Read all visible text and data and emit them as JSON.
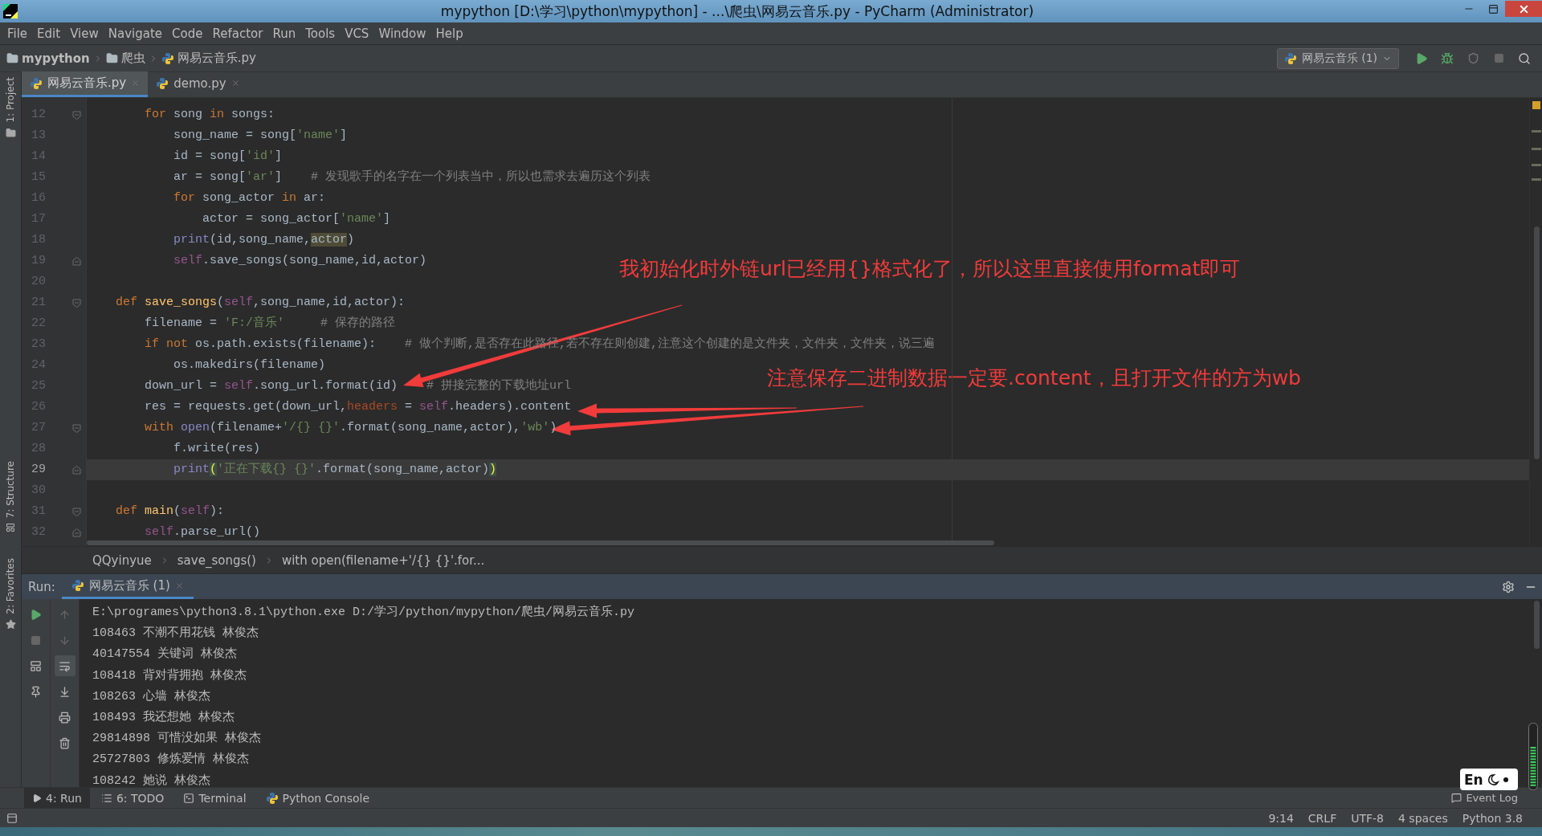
{
  "window": {
    "title": "mypython [D:\\学习\\python\\mypython] - ...\\爬虫\\网易云音乐.py - PyCharm (Administrator)"
  },
  "menu": [
    "File",
    "Edit",
    "View",
    "Navigate",
    "Code",
    "Refactor",
    "Run",
    "Tools",
    "VCS",
    "Window",
    "Help"
  ],
  "navbar": {
    "crumbs": [
      {
        "label": "mypython",
        "kind": "folder"
      },
      {
        "label": "爬虫",
        "kind": "folder"
      },
      {
        "label": "网易云音乐.py",
        "kind": "python"
      }
    ],
    "run_config": "网易云音乐 (1)"
  },
  "side_tools": {
    "top": "1: Project",
    "structure": "7: Structure",
    "favorites": "2: Favorites"
  },
  "editor": {
    "tabs": [
      {
        "label": "网易云音乐.py",
        "selected": true
      },
      {
        "label": "demo.py",
        "selected": false
      }
    ],
    "lines": [
      {
        "number": "12",
        "current": false,
        "fold_start": true,
        "tokens": [
          {
            "kind": "kw",
            "text": "        for"
          },
          {
            "kind": "pl",
            "text": " song "
          },
          {
            "kind": "kw",
            "text": "in"
          },
          {
            "kind": "pl",
            "text": " songs:"
          }
        ]
      },
      {
        "number": "13",
        "current": false,
        "tokens": [
          {
            "kind": "pl",
            "text": "            song_name = song["
          },
          {
            "kind": "str",
            "text": "'name'"
          },
          {
            "kind": "pl",
            "text": "]"
          }
        ]
      },
      {
        "number": "14",
        "current": false,
        "tokens": [
          {
            "kind": "pl",
            "text": "            id = song["
          },
          {
            "kind": "str",
            "text": "'id'"
          },
          {
            "kind": "pl",
            "text": "]"
          }
        ]
      },
      {
        "number": "15",
        "current": false,
        "tokens": [
          {
            "kind": "pl",
            "text": "            ar = song["
          },
          {
            "kind": "str",
            "text": "'ar'"
          },
          {
            "kind": "pl",
            "text": "]"
          },
          {
            "kind": "cm",
            "text": "    # 发现歌手的名字在一个列表当中，所以也需求去遍历这个列表"
          }
        ]
      },
      {
        "number": "16",
        "current": false,
        "tokens": [
          {
            "kind": "kw",
            "text": "            for"
          },
          {
            "kind": "pl",
            "text": " song_actor "
          },
          {
            "kind": "kw",
            "text": "in"
          },
          {
            "kind": "pl",
            "text": " ar:"
          }
        ]
      },
      {
        "number": "17",
        "current": false,
        "tokens": [
          {
            "kind": "pl",
            "text": "                actor = song_actor["
          },
          {
            "kind": "str",
            "text": "'name'"
          },
          {
            "kind": "pl",
            "text": "]"
          }
        ]
      },
      {
        "number": "18",
        "current": false,
        "tokens": [
          {
            "kind": "bi",
            "text": "            print"
          },
          {
            "kind": "pl",
            "text": "(id,song_name,"
          },
          {
            "kind": "hl",
            "text": "actor"
          },
          {
            "kind": "pl",
            "text": ")"
          }
        ]
      },
      {
        "number": "19",
        "current": false,
        "fold_end": true,
        "tokens": [
          {
            "kind": "self",
            "text": "            self"
          },
          {
            "kind": "pl",
            "text": ".save_songs(song_name,id,actor)"
          }
        ]
      },
      {
        "number": "20",
        "current": false
      },
      {
        "number": "21",
        "current": false,
        "fold_start": true,
        "tokens": [
          {
            "kind": "kw",
            "text": "    def"
          },
          {
            "kind": "fn",
            "text": " save_songs"
          },
          {
            "kind": "pl",
            "text": "("
          },
          {
            "kind": "self",
            "text": "self"
          },
          {
            "kind": "pl",
            "text": ",song_name,id,actor):"
          }
        ]
      },
      {
        "number": "22",
        "current": false,
        "tokens": [
          {
            "kind": "pl",
            "text": "        filename = "
          },
          {
            "kind": "str",
            "text": "'F:/音乐'"
          },
          {
            "kind": "cm",
            "text": "     # 保存的路径"
          }
        ]
      },
      {
        "number": "23",
        "current": false,
        "tokens": [
          {
            "kind": "kw",
            "text": "        if not"
          },
          {
            "kind": "pl",
            "text": " os.path.exists(filename):"
          },
          {
            "kind": "cm",
            "text": "    # 做个判断,是否存在此路径,若不存在则创建,注意这个创建的是文件夹，文件夹，文件夹，说三遍"
          }
        ]
      },
      {
        "number": "24",
        "current": false,
        "tokens": [
          {
            "kind": "pl",
            "text": "            os.makedirs(filename)"
          }
        ]
      },
      {
        "number": "25",
        "current": false,
        "tokens": [
          {
            "kind": "pl",
            "text": "        down_url = "
          },
          {
            "kind": "self",
            "text": "self"
          },
          {
            "kind": "pl",
            "text": ".song_url.format(id)"
          },
          {
            "kind": "cm",
            "text": "    # 拼接完整的下载地址url"
          }
        ]
      },
      {
        "number": "26",
        "current": false,
        "tokens": [
          {
            "kind": "pl",
            "text": "        res = requests.get(down_url,"
          },
          {
            "kind": "par",
            "text": "headers"
          },
          {
            "kind": "pl",
            "text": " = "
          },
          {
            "kind": "self",
            "text": "self"
          },
          {
            "kind": "pl",
            "text": ".headers).content"
          }
        ]
      },
      {
        "number": "27",
        "current": false,
        "fold_start": true,
        "tokens": [
          {
            "kind": "kw",
            "text": "        with"
          },
          {
            "kind": "bi",
            "text": " open"
          },
          {
            "kind": "pl",
            "text": "(filename+"
          },
          {
            "kind": "str",
            "text": "'/{} {}'"
          },
          {
            "kind": "pl",
            "text": ".format(song_name,actor),"
          },
          {
            "kind": "str",
            "text": "'wb'"
          },
          {
            "kind": "pl",
            "text": ")"
          }
        ]
      },
      {
        "number": "28",
        "current": false,
        "tokens": [
          {
            "kind": "pl",
            "text": "            f.write(res)"
          }
        ]
      },
      {
        "number": "29",
        "current": true,
        "fold_end": true,
        "tokens": [
          {
            "kind": "bi",
            "text": "            print"
          },
          {
            "kind": "br",
            "text": "("
          },
          {
            "kind": "str",
            "text": "'正在下载{} {}'"
          },
          {
            "kind": "pl",
            "text": ".format(song_name,actor)"
          },
          {
            "kind": "br",
            "text": ")"
          }
        ]
      },
      {
        "number": "30",
        "current": false
      },
      {
        "number": "31",
        "current": false,
        "fold_start": true,
        "tokens": [
          {
            "kind": "kw",
            "text": "    def"
          },
          {
            "kind": "fn",
            "text": " main"
          },
          {
            "kind": "pl",
            "text": "("
          },
          {
            "kind": "self",
            "text": "self"
          },
          {
            "kind": "pl",
            "text": "):"
          }
        ]
      },
      {
        "number": "32",
        "current": false,
        "fold_end": true,
        "tokens": [
          {
            "kind": "self",
            "text": "        self"
          },
          {
            "kind": "pl",
            "text": ".parse_url()"
          }
        ]
      }
    ],
    "annotations": [
      {
        "text": "我初始化时外链url已经用{}格式化了，所以这里直接使用format即可"
      },
      {
        "text": "注意保存二进制数据一定要.content，且打开文件的方为wb"
      }
    ],
    "breadcrumbs": [
      "QQyinyue",
      "save_songs()",
      "with open(filename+'/{} {}'.for..."
    ]
  },
  "run_panel": {
    "label": "Run:",
    "tabs": [
      {
        "label": "网易云音乐 (1)",
        "selected": true
      }
    ],
    "output": [
      "E:\\programes\\python3.8.1\\python.exe D:/学习/python/mypython/爬虫/网易云音乐.py",
      "108463 不潮不用花钱 林俊杰",
      "40147554 关键词 林俊杰",
      "108418 背对背拥抱 林俊杰",
      "108263 心墙 林俊杰",
      "108493 我还想她 林俊杰",
      "29814898 可惜没如果 林俊杰",
      "25727803 修炼爱情 林俊杰",
      "108242 她说 林俊杰"
    ]
  },
  "tool_tabs": [
    {
      "label": "4: Run",
      "kind": "run",
      "selected": true
    },
    {
      "label": "6: TODO",
      "kind": "todo",
      "selected": false
    },
    {
      "label": "Terminal",
      "kind": "terminal",
      "selected": false
    },
    {
      "label": "Python Console",
      "kind": "python",
      "selected": false
    }
  ],
  "event_log": "Event Log",
  "ime": {
    "label": "En"
  },
  "status_bar": [
    "9:14",
    "CRLF",
    "UTF-8",
    "4 spaces",
    "Python 3.8"
  ]
}
